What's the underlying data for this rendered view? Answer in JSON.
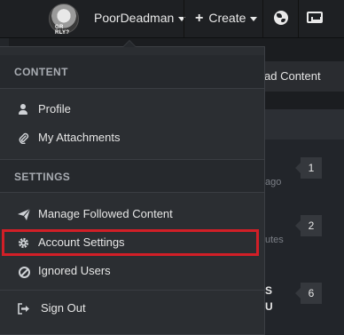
{
  "topbar": {
    "avatar_caption": "GR RLY?",
    "username": "PoorDeadman",
    "create_label": "Create"
  },
  "background": {
    "button_label": "ad Content",
    "timestamps": [
      "ago",
      "utes"
    ],
    "badges": [
      "1",
      "2",
      "6"
    ],
    "bold_fragments": [
      "S",
      "U"
    ]
  },
  "menu": {
    "sections": {
      "content": "CONTENT",
      "settings": "SETTINGS"
    },
    "items": {
      "profile": "Profile",
      "attachments": "My Attachments",
      "followed": "Manage Followed Content",
      "account_settings": "Account Settings",
      "ignored": "Ignored Users",
      "sign_out": "Sign Out"
    },
    "highlight_color": "#d21f27"
  }
}
